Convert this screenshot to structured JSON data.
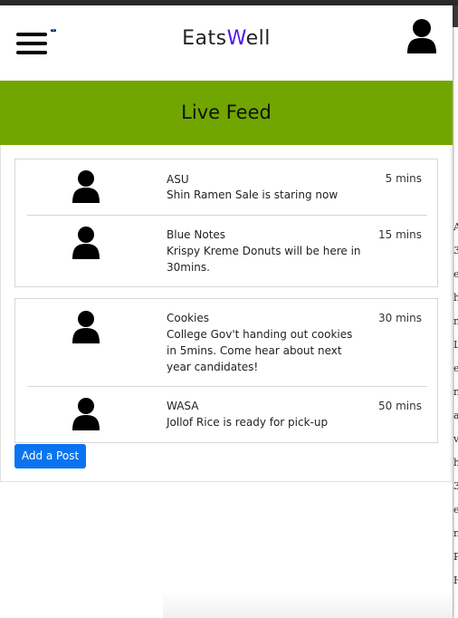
{
  "app": {
    "brand_prefix": "Eats",
    "brand_accent": "W",
    "brand_suffix": "ell",
    "accent_color": "#5218e8"
  },
  "nav": {
    "menu_icon": "hamburger-icon",
    "profile_icon": "user-icon"
  },
  "banner": {
    "title": "Live Feed",
    "color": "#71a600"
  },
  "feed": {
    "groups": [
      {
        "posts": [
          {
            "name": "ASU",
            "message": "Shin Ramen Sale is staring now",
            "time": "5 mins"
          },
          {
            "name": "Blue Notes",
            "message": "Krispy Kreme Donuts will be here in 30mins.",
            "time": "15 mins"
          }
        ]
      },
      {
        "posts": [
          {
            "name": "Cookies",
            "message": "College Gov't handing out cookies in 5mins. Come hear about next year candidates!",
            "time": "30 mins"
          },
          {
            "name": "WASA",
            "message": "Jollof Rice is ready for pick-up",
            "time": "50 mins"
          }
        ]
      }
    ]
  },
  "actions": {
    "add_post_label": "Add a Post",
    "button_color": "#0a74f0"
  },
  "background_page": {
    "edge_chars": [
      "A",
      "3",
      "ep",
      "h",
      "ne",
      "L",
      "e",
      "n",
      "ac",
      "ve",
      "h",
      "3",
      "e",
      "ni",
      "P",
      "H"
    ]
  }
}
